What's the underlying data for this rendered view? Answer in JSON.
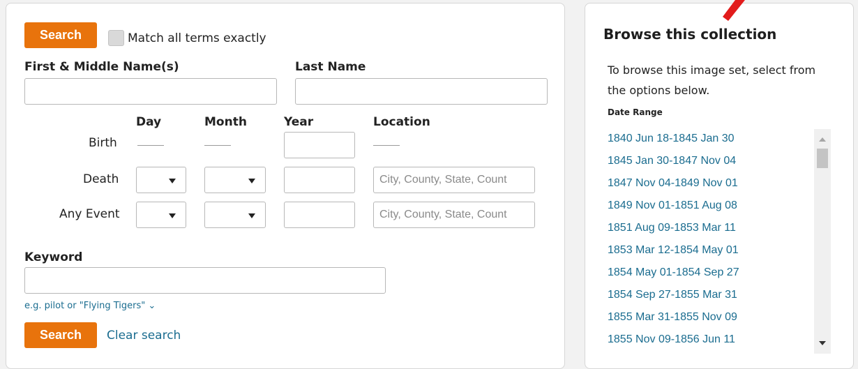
{
  "search": {
    "search_button": "Search",
    "match_exact_label": "Match all terms exactly",
    "first_name_label": "First & Middle Name(s)",
    "last_name_label": "Last Name",
    "col_day": "Day",
    "col_month": "Month",
    "col_year": "Year",
    "col_location": "Location",
    "row_birth": "Birth",
    "row_death": "Death",
    "row_any_event": "Any Event",
    "location_placeholder": "City, County, State, Count",
    "keyword_label": "Keyword",
    "keyword_hint": "e.g. pilot or \"Flying Tigers\"",
    "bottom_search_button": "Search",
    "clear_search": "Clear search"
  },
  "browse": {
    "title": "Browse this collection",
    "description_line1": "To browse this image set, select from",
    "description_line2": "the options below.",
    "date_range_label": "Date Range",
    "date_ranges": [
      "1840 Jun 18-1845 Jan 30",
      "1845 Jan 30-1847 Nov 04",
      "1847 Nov 04-1849 Nov 01",
      "1849 Nov 01-1851 Aug 08",
      "1851 Aug 09-1853 Mar 11",
      "1853 Mar 12-1854 May 01",
      "1854 May 01-1854 Sep 27",
      "1854 Sep 27-1855 Mar 31",
      "1855 Mar 31-1855 Nov 09",
      "1855 Nov 09-1856 Jun 11"
    ]
  },
  "colors": {
    "accent": "#e8730c",
    "link": "#1a6c8f",
    "annotation_arrow": "#e21b1b"
  }
}
